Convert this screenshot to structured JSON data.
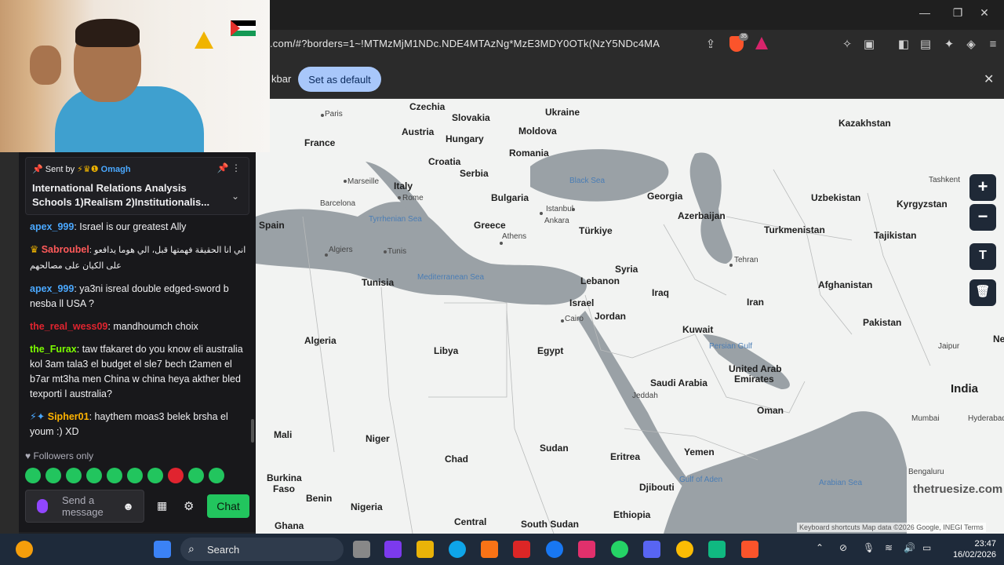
{
  "browser": {
    "url": ".com/#?borders=1~!MTMzMjM1NDc.NDE4MTAzNg*MzE3MDY0OTk(NzY5NDc4MA",
    "brave_badge": "35",
    "infobar_text": "kbar",
    "set_default_label": "Set as default",
    "infobar_close": "✕"
  },
  "map": {
    "countries": [
      "Czechia",
      "Slovakia",
      "Ukraine",
      "Kazakhstan",
      "Austria",
      "Hungary",
      "Moldova",
      "France",
      "Romania",
      "Croatia",
      "Serbia",
      "Italy",
      "Bulgaria",
      "Georgia",
      "Uzbekistan",
      "Kyrgyzstan",
      "Azerbaijan",
      "Spain",
      "Greece",
      "Türkiye",
      "Turkmenistan",
      "Tajikistan",
      "Tunisia",
      "Lebanon",
      "Syria",
      "Iraq",
      "Afghanistan",
      "Iran",
      "Israel",
      "Jordan",
      "Kuwait",
      "Pakistan",
      "Algeria",
      "Libya",
      "Egypt",
      "United Arab",
      "Emirates",
      "Saudi Arabia",
      "India",
      "Oman",
      "Mali",
      "Niger",
      "Chad",
      "Sudan",
      "Eritrea",
      "Yemen",
      "Burkina",
      "Faso",
      "Benin",
      "Nigeria",
      "Djibouti",
      "Ghana",
      "Central",
      "Ethiopia",
      "South Sudan",
      "Ne"
    ],
    "cities": [
      "Paris",
      "Marseille",
      "Rome",
      "Barcelona",
      "Istanbul",
      "Ankara",
      "Athens",
      "Algiers",
      "Tunis",
      "Tehran",
      "Cairo",
      "Jeddah",
      "Jaipur",
      "Hyderabad",
      "Bengaluru",
      "Mumbai",
      "Tashkent"
    ],
    "seas": [
      "Black Sea",
      "Tyrrhenian Sea",
      "Mediterranean Sea",
      "Persian Gulf",
      "Gulf of Aden",
      "Arabian Sea"
    ],
    "watermark": "thetruesize.com",
    "attribution": "Keyboard shortcuts    Map data ©2026 Google, INEGI    Terms",
    "zoom_in": "+",
    "zoom_out": "−",
    "text_tool": "T",
    "delete_tool": "🗑"
  },
  "chat": {
    "pinned": {
      "sent_by_label": "Sent by",
      "sender": "Omagh",
      "title": "International Relations Analysis Schools 1)Realism 2)Institutionalis..."
    },
    "messages": [
      {
        "user": "apex_999",
        "color": "#4aa8ff",
        "text": ": Israel is our greatest Ally"
      },
      {
        "user": "Sabroubel",
        "color": "#ff5a5a",
        "text": ": اني انا الحقيقة فهمتها قبل، الي هوما يدافعو على الكيان على مصالحهم"
      },
      {
        "user": "apex_999",
        "color": "#4aa8ff",
        "text": ": ya3ni isreal double edged-sword b nesba ll USA ?"
      },
      {
        "user": "the_real_wess09",
        "color": "#e0242f",
        "text": ": mandhoumch choix"
      },
      {
        "user": "the_Furax",
        "color": "#7cfc00",
        "text": ": taw tfakaret do you know eli australia kol 3am tala3 el budget el sle7 bech t2amen el b7ar mt3ha men China w china heya akther bled texporti l australia?"
      },
      {
        "user": "Sipher01",
        "color": "#ffb300",
        "text": ": haythem moas3 belek brsha el youm :) XD"
      }
    ],
    "followers_only": "Followers only",
    "input_placeholder": "Send a message",
    "chat_button": "Chat"
  },
  "taskbar": {
    "search_label": "Search",
    "time": "23:47",
    "date": "16/02/2026"
  }
}
